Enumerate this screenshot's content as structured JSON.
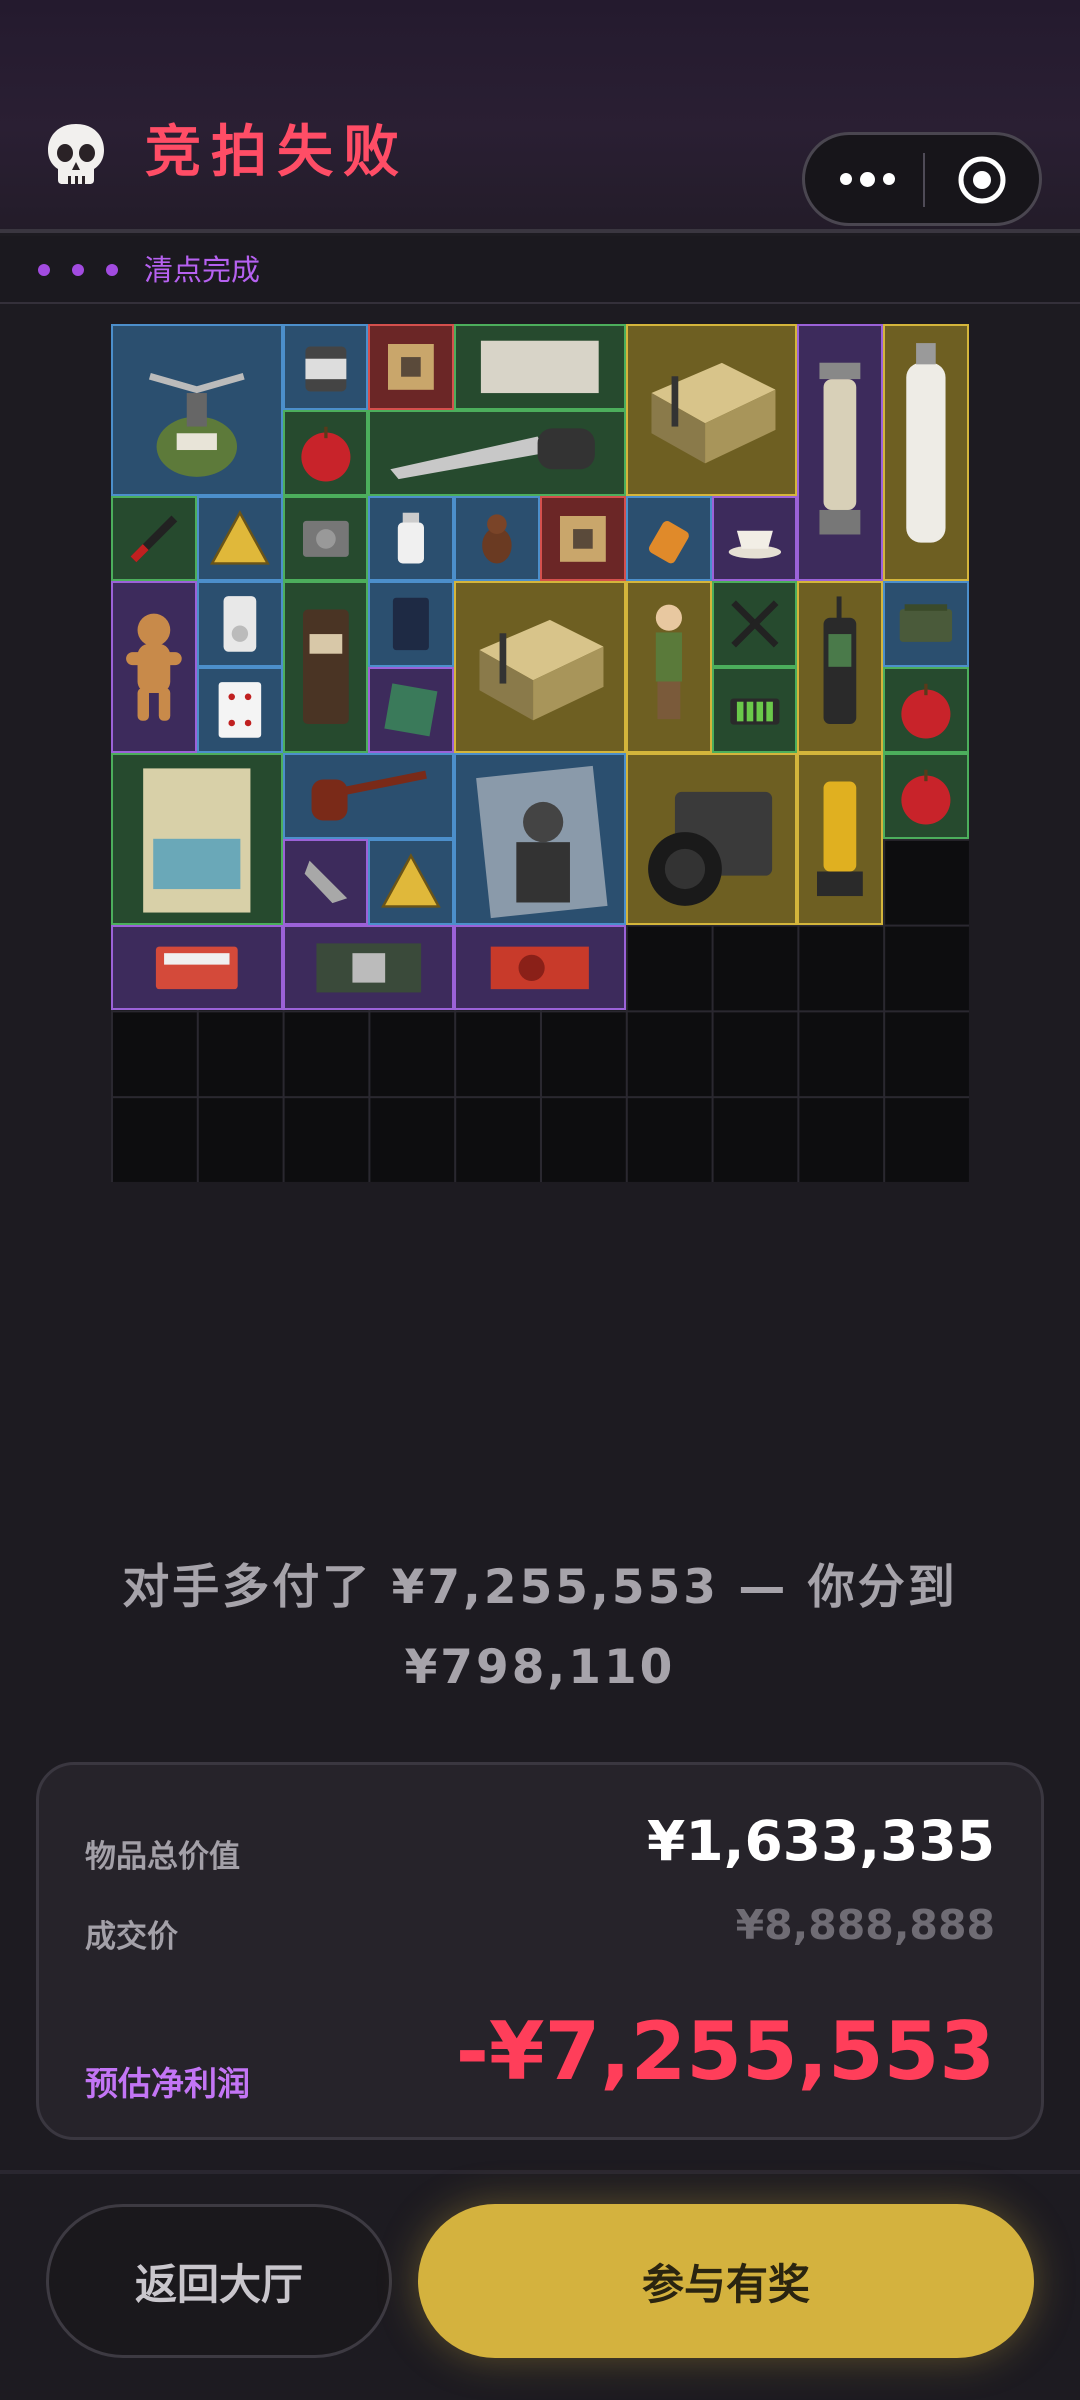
{
  "header": {
    "icon": "skull-icon",
    "title": "竞拍失败",
    "title_color": "#ff4d66",
    "capsule": {
      "more_icon": "more-dots-icon",
      "close_icon": "target-close-icon"
    }
  },
  "status": {
    "icon": "loading-dots-icon",
    "text": "清点完成",
    "color": "#b661f0"
  },
  "inventory": {
    "items": [
      {
        "name": "camping-stove-icon",
        "rarity": "blue"
      },
      {
        "name": "canister-icon",
        "rarity": "blue"
      },
      {
        "name": "circuit-chip-icon",
        "rarity": "red"
      },
      {
        "name": "paper-sheet-icon",
        "rarity": "green"
      },
      {
        "name": "supply-crate-icon",
        "rarity": "gold"
      },
      {
        "name": "lantern-icon",
        "rarity": "purple"
      },
      {
        "name": "oxygen-tank-icon",
        "rarity": "gold"
      },
      {
        "name": "apple-icon",
        "rarity": "green"
      },
      {
        "name": "hand-saw-icon",
        "rarity": "green"
      },
      {
        "name": "screwdriver-icon",
        "rarity": "green"
      },
      {
        "name": "warning-sign-icon",
        "rarity": "blue"
      },
      {
        "name": "hard-drive-icon",
        "rarity": "green"
      },
      {
        "name": "medicine-bottle-icon",
        "rarity": "blue"
      },
      {
        "name": "bird-figurine-icon",
        "rarity": "blue"
      },
      {
        "name": "circuit-chip-icon",
        "rarity": "red"
      },
      {
        "name": "pill-bottle-icon",
        "rarity": "blue"
      },
      {
        "name": "teacup-icon",
        "rarity": "purple"
      },
      {
        "name": "gingerbread-man-icon",
        "rarity": "purple"
      },
      {
        "name": "mp3-player-icon",
        "rarity": "blue"
      },
      {
        "name": "coffee-bag-icon",
        "rarity": "green"
      },
      {
        "name": "coffee-pouch-icon",
        "rarity": "blue"
      },
      {
        "name": "supply-crate-icon",
        "rarity": "gold"
      },
      {
        "name": "boy-figurine-icon",
        "rarity": "gold"
      },
      {
        "name": "pliers-icon",
        "rarity": "green"
      },
      {
        "name": "radio-phone-icon",
        "rarity": "gold"
      },
      {
        "name": "ammo-box-icon",
        "rarity": "blue"
      },
      {
        "name": "playing-card-icon",
        "rarity": "blue"
      },
      {
        "name": "processor-icon",
        "rarity": "purple"
      },
      {
        "name": "battery-pack-icon",
        "rarity": "green"
      },
      {
        "name": "apple-icon",
        "rarity": "green"
      },
      {
        "name": "postcard-icon",
        "rarity": "green"
      },
      {
        "name": "tobacco-pipe-icon",
        "rarity": "blue"
      },
      {
        "name": "magazine-icon",
        "rarity": "blue"
      },
      {
        "name": "camera-icon",
        "rarity": "gold"
      },
      {
        "name": "fuel-canister-icon",
        "rarity": "gold"
      },
      {
        "name": "apple-icon",
        "rarity": "green"
      },
      {
        "name": "arrowhead-icon",
        "rarity": "purple"
      },
      {
        "name": "warning-sign-icon",
        "rarity": "blue"
      },
      {
        "name": "ssd-card-icon",
        "rarity": "purple"
      },
      {
        "name": "circuit-board-icon",
        "rarity": "purple"
      },
      {
        "name": "graphics-card-icon",
        "rarity": "purple"
      }
    ]
  },
  "result": {
    "message_line1": "对手多付了 ¥7,255,553 — 你分到",
    "message_line2": "¥798,110"
  },
  "summary": {
    "total_label": "物品总价值",
    "total_value": "¥1,633,335",
    "deal_label": "成交价",
    "deal_value": "¥8,888,888",
    "profit_label": "预估净利润",
    "profit_value": "-¥7,255,553",
    "profit_color": "#ff3e5a"
  },
  "buttons": {
    "back": "返回大厅",
    "join": "参与有奖"
  }
}
